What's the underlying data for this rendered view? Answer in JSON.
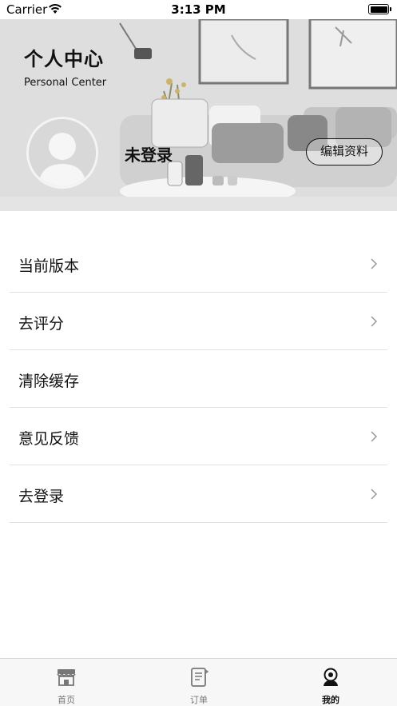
{
  "status_bar": {
    "carrier": "Carrier",
    "time": "3:13 PM"
  },
  "header": {
    "title": "个人中心",
    "subtitle": "Personal Center",
    "username": "未登录",
    "edit_button": "编辑资料"
  },
  "menu": [
    {
      "label": "当前版本",
      "chevron": true
    },
    {
      "label": "去评分",
      "chevron": true
    },
    {
      "label": "清除缓存",
      "chevron": false
    },
    {
      "label": "意见反馈",
      "chevron": true
    },
    {
      "label": "去登录",
      "chevron": true
    }
  ],
  "tabbar": [
    {
      "label": "首页",
      "icon": "store-icon",
      "active": false
    },
    {
      "label": "订单",
      "icon": "order-icon",
      "active": false
    },
    {
      "label": "我的",
      "icon": "profile-icon",
      "active": true
    }
  ]
}
